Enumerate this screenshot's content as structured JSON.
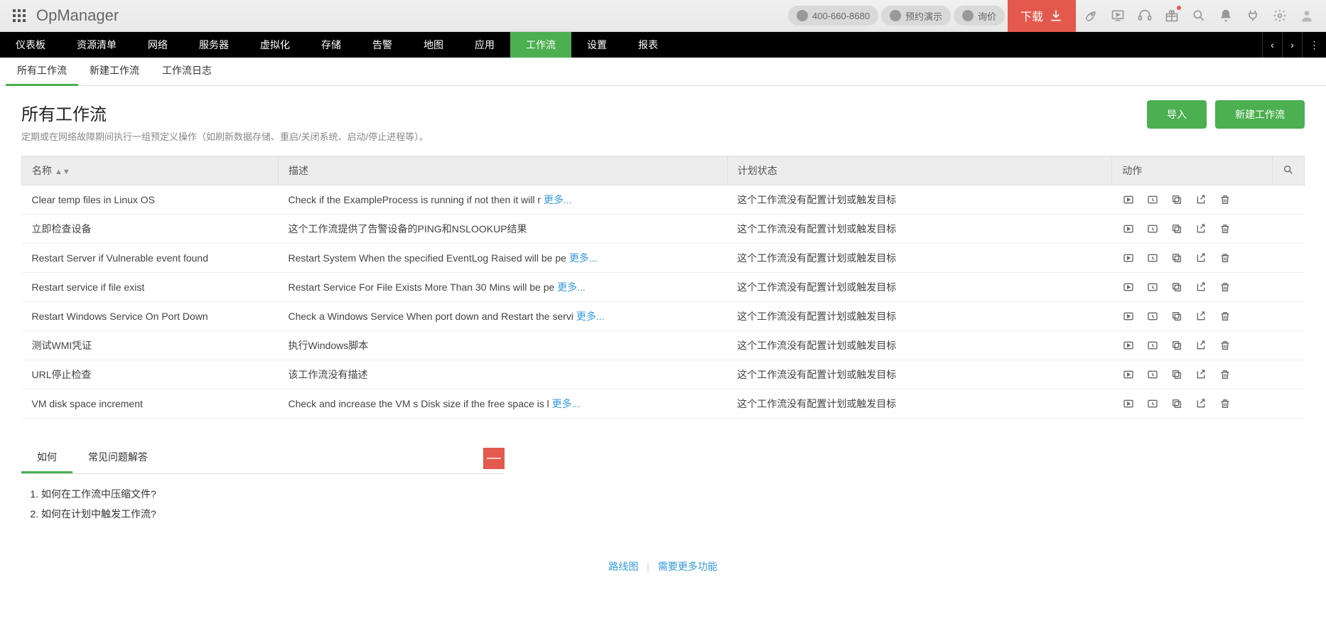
{
  "brand": "OpManager",
  "topbar": {
    "phone": "400-660-8680",
    "demo": "预约演示",
    "quote": "询价",
    "download": "下载"
  },
  "nav": {
    "items": [
      "仪表板",
      "资源清单",
      "网络",
      "服务器",
      "虚拟化",
      "存储",
      "告警",
      "地图",
      "应用",
      "工作流",
      "设置",
      "报表"
    ],
    "active_index": 9
  },
  "subnav": {
    "items": [
      "所有工作流",
      "新建工作流",
      "工作流日志"
    ],
    "active_index": 0
  },
  "page": {
    "title": "所有工作流",
    "subtitle": "定期或在网络故障期间执行一组预定义操作（如刷新数据存储、重启/关闭系统、启动/停止进程等）。",
    "import_btn": "导入",
    "create_btn": "新建工作流"
  },
  "table": {
    "headers": {
      "name": "名称",
      "desc": "描述",
      "status": "计划状态",
      "actions": "动作"
    },
    "more": "更多...",
    "rows": [
      {
        "name": "Clear temp files in Linux OS",
        "desc": "Check if the ExampleProcess is running if not then it will r ",
        "more": true,
        "status": "这个工作流没有配置计划或触发目标"
      },
      {
        "name": "立即检查设备",
        "desc": "这个工作流提供了告警设备的PING和NSLOOKUP结果",
        "more": false,
        "status": "这个工作流没有配置计划或触发目标"
      },
      {
        "name": "Restart Server if Vulnerable event found",
        "desc": "Restart System When the specified EventLog Raised will be pe ",
        "more": true,
        "status": "这个工作流没有配置计划或触发目标"
      },
      {
        "name": "Restart service if file exist",
        "desc": "Restart Service For File Exists More Than 30 Mins will be pe ",
        "more": true,
        "status": "这个工作流没有配置计划或触发目标"
      },
      {
        "name": "Restart Windows Service On Port Down",
        "desc": "Check a Windows Service When port down and Restart the servi ",
        "more": true,
        "status": "这个工作流没有配置计划或触发目标"
      },
      {
        "name": "测试WMI凭证",
        "desc": "执行Windows脚本",
        "more": false,
        "status": "这个工作流没有配置计划或触发目标"
      },
      {
        "name": "URL停止检查",
        "desc": "该工作流没有描述",
        "more": false,
        "status": "这个工作流没有配置计划或触发目标"
      },
      {
        "name": "VM disk space increment",
        "desc": "Check and increase the VM s Disk size if the free space is l ",
        "more": true,
        "status": "这个工作流没有配置计划或触发目标"
      }
    ]
  },
  "help": {
    "tabs": [
      "如何",
      "常见问题解答"
    ],
    "active_index": 0,
    "collapse": "—",
    "items": [
      "如何在工作流中压缩文件?",
      "如何在计划中触发工作流?"
    ]
  },
  "footer": {
    "roadmap": "路线图",
    "more_features": "需要更多功能"
  }
}
